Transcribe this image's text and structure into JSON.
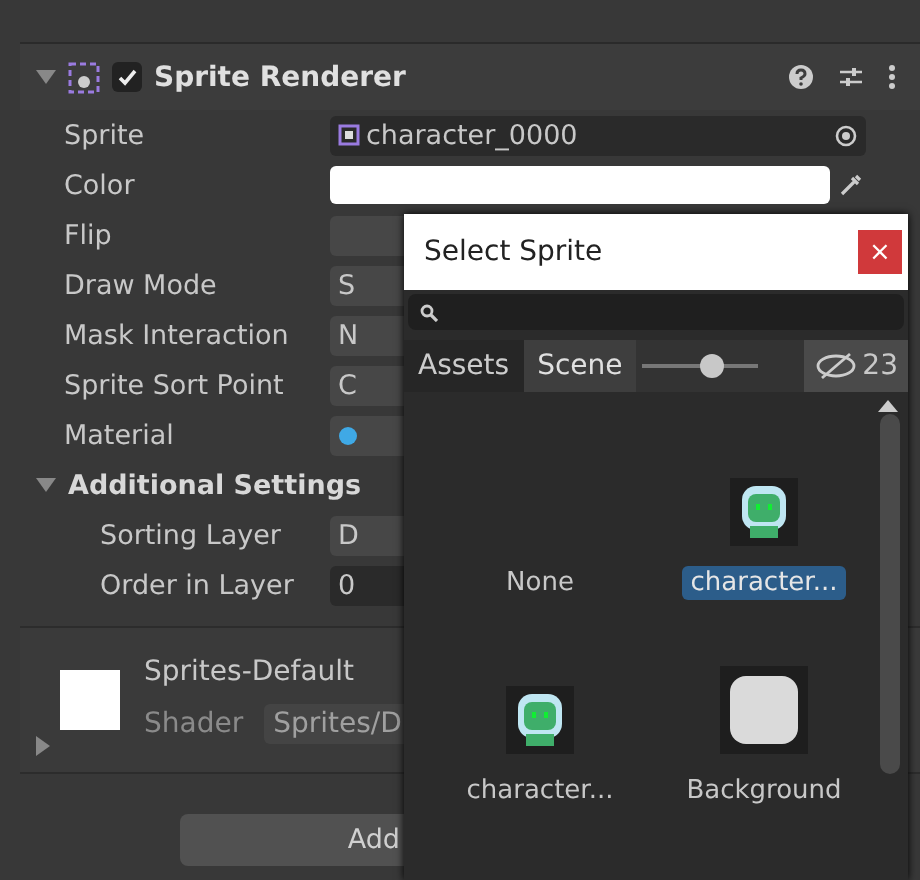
{
  "component": {
    "title": "Sprite Renderer",
    "enabled": true,
    "expanded": true
  },
  "properties": [
    {
      "label": "Sprite",
      "kind": "object",
      "value": "character_0000"
    },
    {
      "label": "Color",
      "kind": "color",
      "color": "#ffffff"
    },
    {
      "label": "Flip",
      "kind": "toggles"
    },
    {
      "label": "Draw Mode",
      "kind": "dropdown",
      "value": "S"
    },
    {
      "label": "Mask Interaction",
      "kind": "dropdown",
      "value": "N"
    },
    {
      "label": "Sprite Sort Point",
      "kind": "dropdown",
      "value": "C"
    },
    {
      "label": "Material",
      "kind": "material"
    }
  ],
  "additional_settings": {
    "title": "Additional Settings",
    "expanded": true,
    "properties": [
      {
        "label": "Sorting Layer",
        "kind": "dropdown",
        "value": "D"
      },
      {
        "label": "Order in Layer",
        "kind": "number",
        "value": "0"
      }
    ]
  },
  "material": {
    "name": "Sprites-Default",
    "shader_label": "Shader",
    "shader": "Sprites/D",
    "expanded": false
  },
  "add_button": "Add",
  "picker": {
    "title": "Select Sprite",
    "close": "×",
    "tabs": [
      {
        "label": "Assets",
        "selected": false
      },
      {
        "label": "Scene",
        "selected": true
      }
    ],
    "zoom_slider": {
      "level": 0.6
    },
    "hidden_count": "23",
    "items": [
      {
        "label": "None",
        "kind": "none",
        "selected": false
      },
      {
        "label": "character...",
        "kind": "character",
        "selected": true
      },
      {
        "label": "character...",
        "kind": "character",
        "selected": false
      },
      {
        "label": "Background",
        "kind": "square",
        "selected": false
      }
    ]
  }
}
